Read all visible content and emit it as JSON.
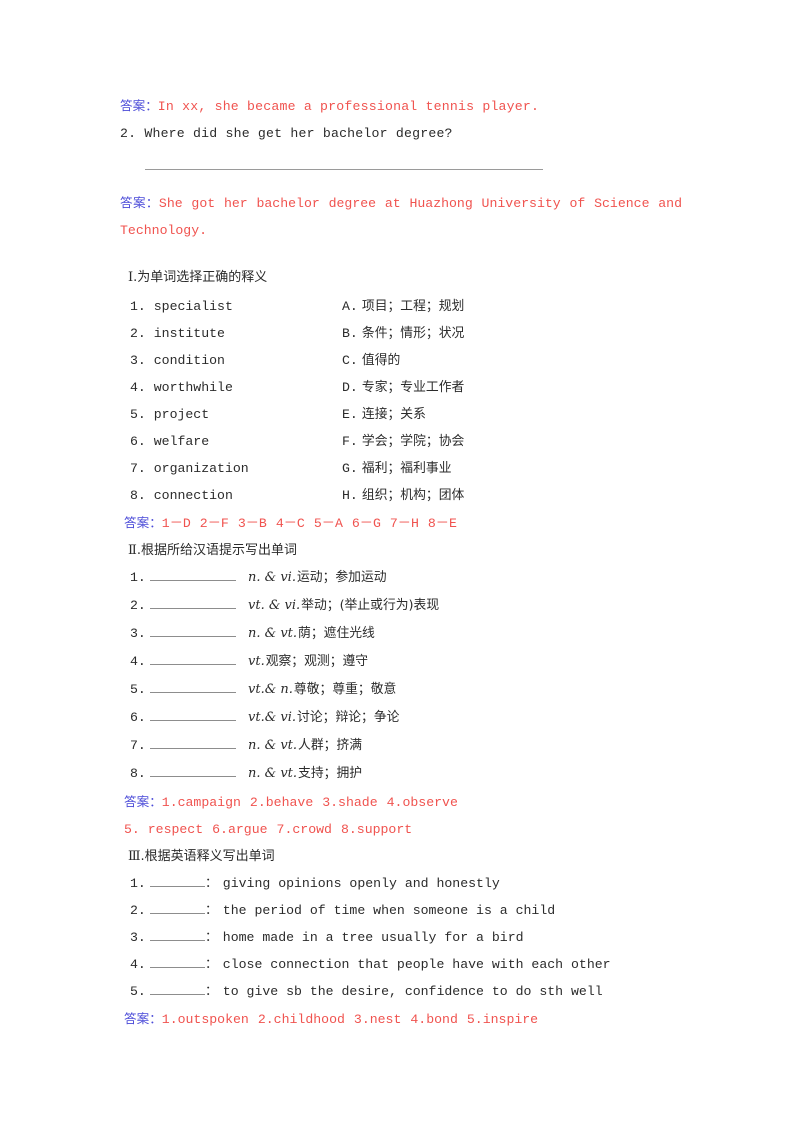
{
  "top": {
    "answer_label": "答案：",
    "answer_1": "In xx, she became a professional tennis player.",
    "question_2": "2. Where did she get her bachelor degree?",
    "answer_2": "She got her bachelor degree at Huazhong University of Science and Technology."
  },
  "section1": {
    "heading_numeral": "Ⅰ",
    "heading": ".为单词选择正确的释义",
    "left": [
      "1. specialist",
      "2. institute",
      "3. condition",
      "4. worthwhile",
      "5. project",
      "6. welfare",
      "7. organization",
      "8. connection"
    ],
    "right_letters": [
      "A.",
      "B.",
      "C.",
      "D.",
      "E.",
      "F.",
      "G.",
      "H."
    ],
    "right_meanings": [
      "项目；工程；规划",
      "条件；情形；状况",
      "值得的",
      "专家；专业工作者",
      "连接；关系",
      "学会；学院；协会",
      "福利；福利事业",
      "组织；机构；团体"
    ],
    "answer_label": "答案：",
    "answers": [
      "1－D",
      "2－F",
      "3－B",
      "4－C",
      "5－A",
      "6－G",
      "7－H",
      "8－E"
    ]
  },
  "section2": {
    "heading_numeral": "Ⅱ",
    "heading": ".根据所给汉语提示写出单词",
    "rows": [
      {
        "num": "1.",
        "pos": "n. & vi.",
        "cn": "运动；参加运动"
      },
      {
        "num": "2.",
        "pos": "vt. & vi.",
        "cn": "举动；(举止或行为)表现"
      },
      {
        "num": "3.",
        "pos": "n. & vt.",
        "cn": "荫；遮住光线"
      },
      {
        "num": "4.",
        "pos": "vt.",
        "cn": "观察；观测；遵守"
      },
      {
        "num": "5.",
        "pos": "vt.& n.",
        "cn": "尊敬；尊重；敬意"
      },
      {
        "num": "6.",
        "pos": "vt.& vi.",
        "cn": "讨论；辩论；争论"
      },
      {
        "num": "7.",
        "pos": "n. & vt.",
        "cn": "人群；挤满"
      },
      {
        "num": "8.",
        "pos": "n. & vt.",
        "cn": "支持；拥护"
      }
    ],
    "answer_label": "答案：",
    "answers_line1": [
      "1.campaign",
      "2.behave",
      "3.shade",
      "4.observe"
    ],
    "answers_line2": [
      "5. respect",
      "6.argue",
      "7.crowd",
      "8.support"
    ]
  },
  "section3": {
    "heading_numeral": "Ⅲ",
    "heading": ".根据英语释义写出单词",
    "rows": [
      {
        "num": "1.",
        "def": "giving opinions openly and honestly"
      },
      {
        "num": "2.",
        "def": "the period of time when someone is a child"
      },
      {
        "num": "3.",
        "def": "home made in a tree usually for a bird"
      },
      {
        "num": "4.",
        "def": "close connection that people have with each other"
      },
      {
        "num": "5.",
        "def": "to give sb the desire, confidence to do sth well"
      }
    ],
    "colon": "：",
    "answer_label": "答案：",
    "answers": [
      "1.outspoken",
      "2.childhood",
      "3.nest",
      "4.bond",
      "5.inspire"
    ]
  },
  "colors": {
    "answer_label": "#4b4bd8",
    "answer_text": "#f0534f",
    "body_text": "#2b2b2b",
    "rule": "#9a9a9a"
  }
}
